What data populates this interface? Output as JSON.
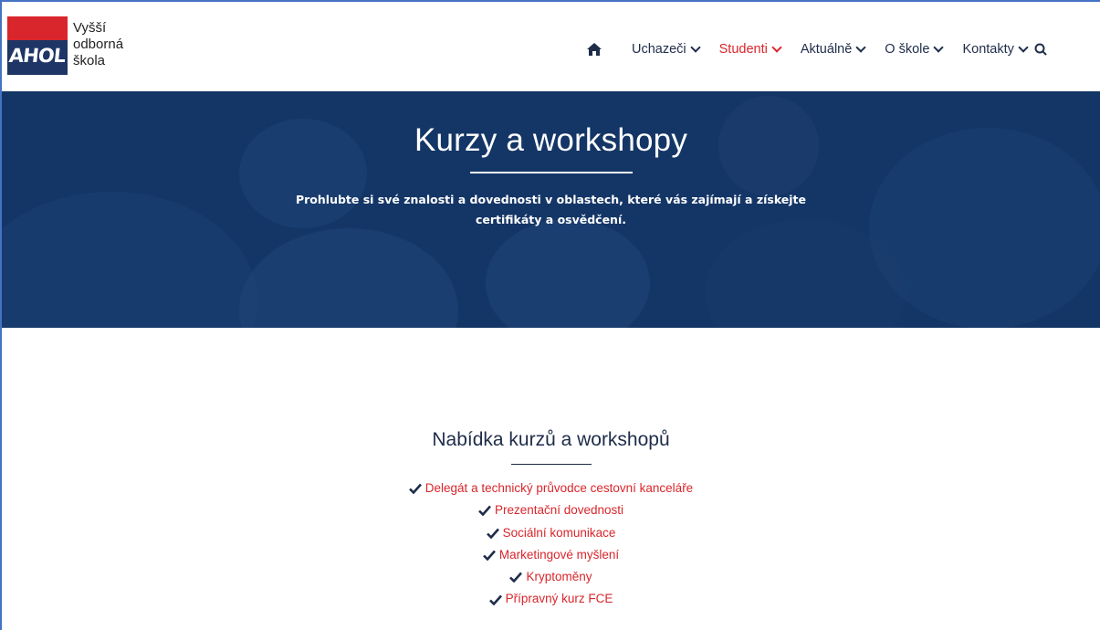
{
  "header": {
    "logo_mark": "AHOL",
    "logo_text": [
      "Vyšší",
      "odborná",
      "škola"
    ],
    "nav": {
      "home_icon": "home-icon",
      "items": [
        {
          "label": "Uchazeči",
          "active": false
        },
        {
          "label": "Studenti",
          "active": true
        },
        {
          "label": "Aktuálně",
          "active": false
        },
        {
          "label": "O škole",
          "active": false
        },
        {
          "label": "Kontakty",
          "active": false
        }
      ],
      "search_icon": "search-icon"
    }
  },
  "hero": {
    "title": "Kurzy a workshopy",
    "subtitle": "Prohlubte si své znalosti a dovednosti v oblastech, které vás zajímají a získejte certifikáty a osvědčení."
  },
  "main": {
    "section_title": "Nabídka kurzů a workshopů",
    "courses": [
      "Delegát a technický průvodce cestovní kanceláře",
      "Prezentační dovednosti",
      "Sociální komunikace",
      "Marketingové myšlení",
      "Kryptoměny",
      "Přípravný kurz FCE"
    ]
  },
  "colors": {
    "accent": "#d9262c",
    "navy": "#1f2c4a",
    "hero_bg": "#153766"
  }
}
